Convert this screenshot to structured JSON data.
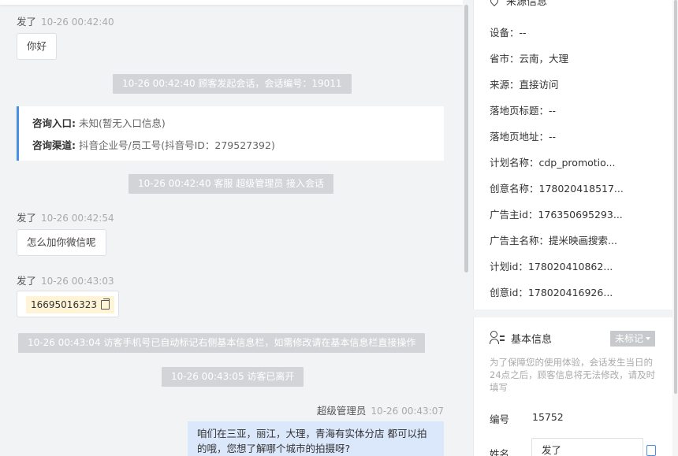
{
  "chat": {
    "messages": [
      {
        "sender": "发了",
        "time": "10-26 00:42:40",
        "text": "你好"
      },
      {
        "sender": "发了",
        "time": "10-26 00:42:54",
        "text": "怎么加你微信呢"
      },
      {
        "sender": "发了",
        "time": "10-26 00:43:03",
        "text": "16695016323"
      }
    ],
    "system": [
      "10-26 00:42:40 顾客发起会话，会话编号：19011",
      "10-26 00:42:40 客服 超级管理员 接入会话",
      "10-26 00:43:04 访客手机号已自动标记右侧基本信息栏，如需修改请在基本信息栏直接操作",
      "10-26 00:43:05 访客已离开"
    ],
    "info_card": {
      "entry_label": "咨询入口:",
      "entry_value": "未知(暂无入口信息)",
      "channel_label": "咨询渠道:",
      "channel_value": "抖音企业号/员工号(抖音号ID：279527392)"
    },
    "agent": {
      "name": "超级管理员",
      "time": "10-26 00:43:07",
      "text": "咱们在三亚，丽江，大理，青海有实体分店 都可以拍的哦，您想了解哪个城市的拍摄呀?"
    }
  },
  "source_info": {
    "title": "来源信息",
    "rows": [
      "设备：--",
      "省市：云南，大理",
      "来源：直接访问",
      "落地页标题：--",
      "落地页地址：--",
      "计划名称：cdp_promotio...",
      "创意名称：178020418517...",
      "广告主id：176350695293...",
      "广告主名称：提米映画搜索...",
      "计划id：178020410862...",
      "创意id：178020416926..."
    ]
  },
  "basic_info": {
    "title": "基本信息",
    "tag_button": "未标记",
    "notice": "为了保障您的使用体验，会话发生当日的24点之后，顾客信息将无法修改，请及时填写",
    "id_label": "编号",
    "id_value": "15752",
    "name_label": "姓名",
    "name_value": "发了"
  },
  "colors": {
    "accent": "#4a90e2",
    "system_bg": "#d2d4d7",
    "chat_bg": "#f2f3f5",
    "agent_bubble": "#dbe7fb"
  }
}
